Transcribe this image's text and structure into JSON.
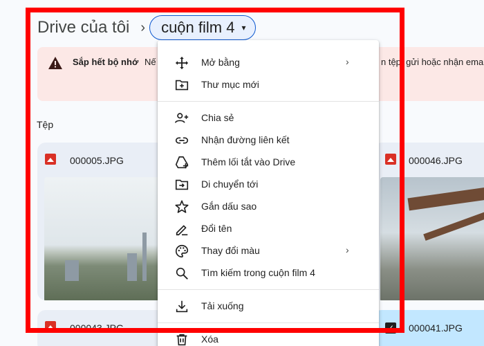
{
  "breadcrumb": {
    "root": "Drive của tôi",
    "separator": "›",
    "current": "cuộn film 4",
    "caret": "▾"
  },
  "banner": {
    "title": "Sắp hết bộ nhớ",
    "text": "Nế",
    "text_right": "n tệp, gửi hoặc nhận ema"
  },
  "section_label": "Tệp",
  "files": [
    {
      "name": "000005.JPG"
    },
    {
      "name": "000043.JPG"
    },
    {
      "name": "000046.JPG"
    },
    {
      "name": "000041.JPG",
      "selected": true
    }
  ],
  "menu": {
    "items": [
      {
        "label": "Mở bằng",
        "icon": "move-icon",
        "submenu": "›"
      },
      {
        "label": "Thư mục mới",
        "icon": "new-folder-icon"
      },
      {
        "label": "Chia sẻ",
        "icon": "person-add-icon"
      },
      {
        "label": "Nhận đường liên kết",
        "icon": "link-icon"
      },
      {
        "label": "Thêm lối tắt vào Drive",
        "icon": "drive-shortcut-icon"
      },
      {
        "label": "Di chuyển tới",
        "icon": "move-to-folder-icon"
      },
      {
        "label": "Gắn dấu sao",
        "icon": "star-icon"
      },
      {
        "label": "Đổi tên",
        "icon": "pencil-icon"
      },
      {
        "label": "Thay đổi màu",
        "icon": "palette-icon",
        "submenu": "›"
      },
      {
        "label": "Tìm kiếm trong cuộn film 4",
        "icon": "search-icon"
      },
      {
        "label": "Tải xuống",
        "icon": "download-icon"
      },
      {
        "label": "Xóa",
        "icon": "trash-icon"
      }
    ]
  },
  "colors": {
    "highlight_frame": "#ff0000",
    "chip_border": "#0b57d0",
    "banner_bg": "#fce8e6",
    "image_icon": "#d93025"
  }
}
